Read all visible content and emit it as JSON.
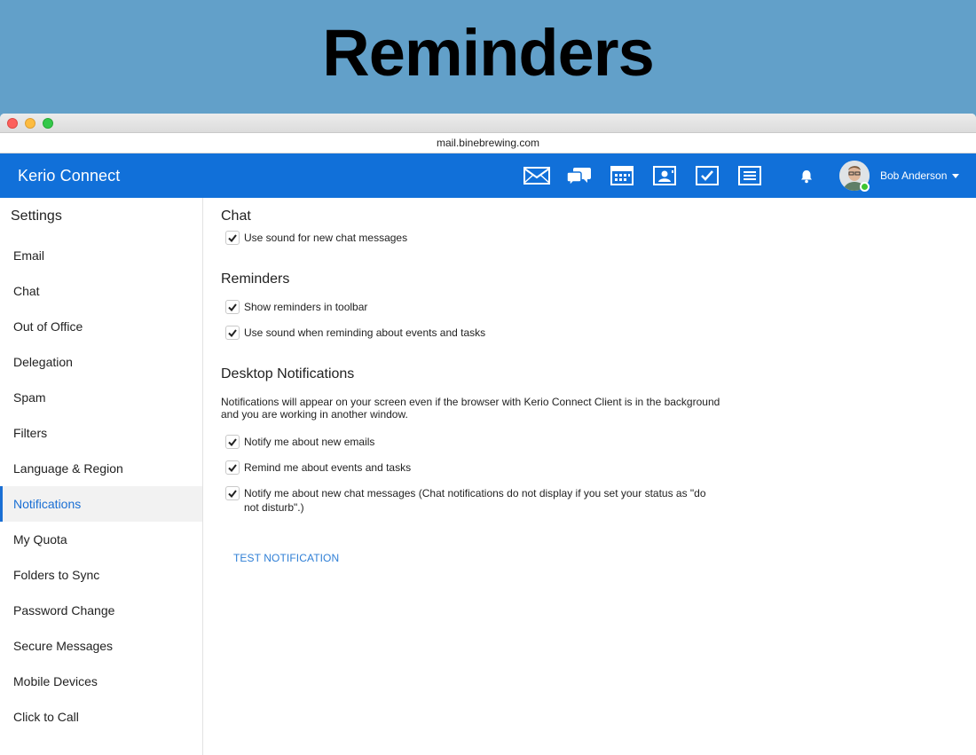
{
  "banner": {
    "title": "Reminders"
  },
  "browser": {
    "url": "mail.binebrewing.com"
  },
  "header": {
    "brand": "Kerio Connect",
    "apps": [
      {
        "name": "mail",
        "icon": "mail-icon"
      },
      {
        "name": "chat",
        "icon": "chat-icon"
      },
      {
        "name": "calendar",
        "icon": "calendar-icon"
      },
      {
        "name": "contacts",
        "icon": "contacts-icon"
      },
      {
        "name": "tasks",
        "icon": "tasks-icon"
      },
      {
        "name": "notes",
        "icon": "notes-icon"
      }
    ],
    "user_name": "Bob Anderson",
    "status_color": "#3ec531"
  },
  "sidebar": {
    "title": "Settings",
    "items": [
      {
        "label": "Email"
      },
      {
        "label": "Chat"
      },
      {
        "label": "Out of Office"
      },
      {
        "label": "Delegation"
      },
      {
        "label": "Spam"
      },
      {
        "label": "Filters"
      },
      {
        "label": "Language & Region"
      },
      {
        "label": "Notifications",
        "active": true
      },
      {
        "label": "My Quota"
      },
      {
        "label": "Folders to Sync"
      },
      {
        "label": "Password Change"
      },
      {
        "label": "Secure Messages"
      },
      {
        "label": "Mobile Devices"
      },
      {
        "label": "Click to Call"
      }
    ]
  },
  "main": {
    "chat": {
      "title": "Chat",
      "options": [
        {
          "label": "Use sound for new chat messages",
          "checked": true
        }
      ]
    },
    "reminders": {
      "title": "Reminders",
      "options": [
        {
          "label": "Show reminders in toolbar",
          "checked": true
        },
        {
          "label": "Use sound when reminding about events and tasks",
          "checked": true
        }
      ]
    },
    "desktop": {
      "title": "Desktop Notifications",
      "description": "Notifications will appear on your screen even if the browser with Kerio Connect Client is in the background and you are working in another window.",
      "options": [
        {
          "label": "Notify me about new emails",
          "checked": true
        },
        {
          "label": "Remind me about events and tasks",
          "checked": true
        },
        {
          "label": "Notify me about new chat messages (Chat notifications do not display if you set your status as \"do not disturb\".)",
          "checked": true
        }
      ]
    },
    "test_button": "TEST NOTIFICATION"
  },
  "colors": {
    "brand_blue": "#1170d9",
    "accent": "#1a6fd4",
    "banner": "#62a0c9"
  }
}
